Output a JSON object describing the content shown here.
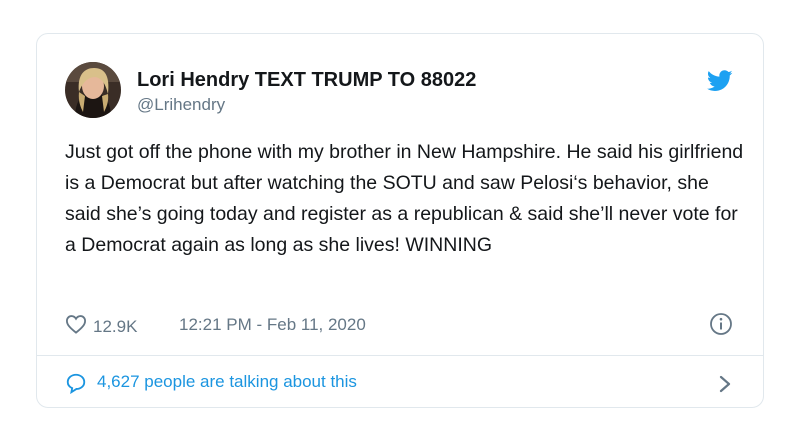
{
  "tweet": {
    "author": {
      "display_name": "Lori Hendry TEXT TRUMP TO 88022",
      "handle": "@Lrihendry",
      "avatar_icon": "user-avatar"
    },
    "brand_icon": "twitter-bird-icon",
    "brand_color": "#1da1f2",
    "text": "Just got off the phone with my brother in New Hampshire. He said his girlfriend is a Democrat but after watching the SOTU and saw Pelosi‘s behavior, she said she’s going today and register as a republican & said she’ll never vote for a Democrat again as long as she lives! WINNING",
    "like_count": "12.9K",
    "timestamp": "12:21 PM - Feb 11, 2020",
    "talking_about": "4,627 people are talking about this",
    "link_color": "#1b95e0",
    "icons": {
      "like": "heart-icon",
      "info": "info-icon",
      "reply": "speech-bubble-icon",
      "chevron": "chevron-right-icon"
    }
  }
}
